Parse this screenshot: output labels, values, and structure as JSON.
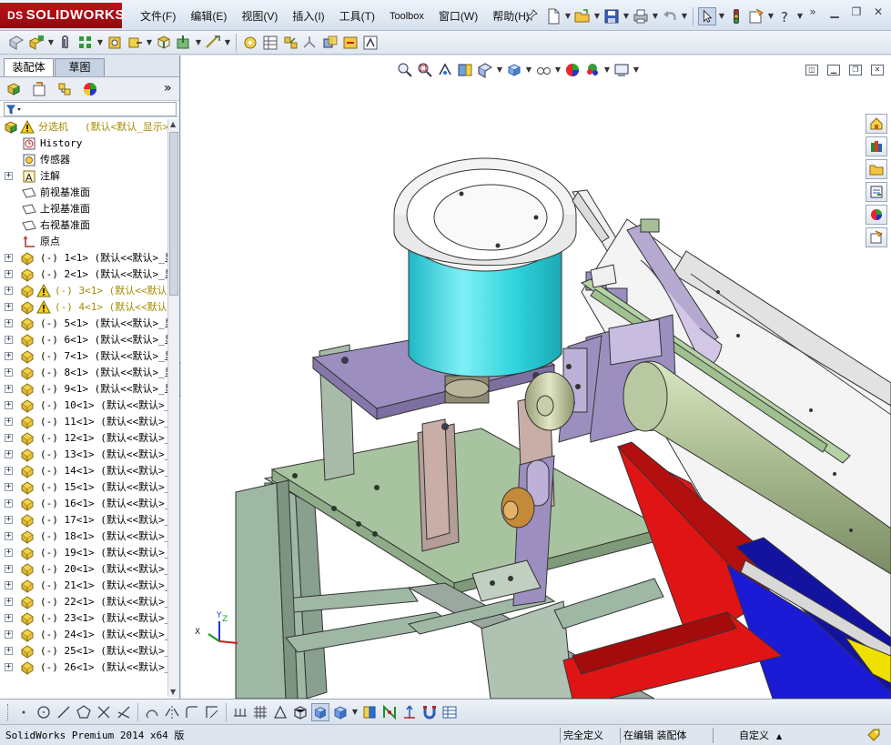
{
  "app": {
    "brand_mark": "DS",
    "brand": "SOLIDWORKS"
  },
  "menu": [
    {
      "label": "文件(F)"
    },
    {
      "label": "编辑(E)"
    },
    {
      "label": "视图(V)"
    },
    {
      "label": "插入(I)"
    },
    {
      "label": "工具(T)"
    },
    {
      "label": "Toolbox"
    },
    {
      "label": "窗口(W)"
    },
    {
      "label": "帮助(H)"
    }
  ],
  "panel": {
    "tabs": [
      {
        "label": "装配体"
      },
      {
        "label": "草图"
      }
    ],
    "expand_glyph": "»"
  },
  "tree": {
    "root": {
      "label": "分选机",
      "config": "(默认<默认_显示>"
    },
    "items": [
      {
        "label": "History"
      },
      {
        "label": "传感器"
      },
      {
        "label": "注解"
      },
      {
        "label": "前视基准面"
      },
      {
        "label": "上视基准面"
      },
      {
        "label": "右视基准面"
      },
      {
        "label": "原点"
      }
    ],
    "parts": [
      {
        "label": "(-) 1<1> (默认<<默认>_显",
        "warn": false
      },
      {
        "label": "(-) 2<1> (默认<<默认>_显",
        "warn": false
      },
      {
        "label": "(-) 3<1> (默认<<默认",
        "warn": true
      },
      {
        "label": "(-) 4<1> (默认<<默认",
        "warn": true
      },
      {
        "label": "(-) 5<1> (默认<<默认>_显",
        "warn": false
      },
      {
        "label": "(-) 6<1> (默认<<默认>_显",
        "warn": false
      },
      {
        "label": "(-) 7<1> (默认<<默认>_显",
        "warn": false
      },
      {
        "label": "(-) 8<1> (默认<<默认>_显",
        "warn": false
      },
      {
        "label": "(-) 9<1> (默认<<默认>_显",
        "warn": false
      },
      {
        "label": "(-) 10<1> (默认<<默认>_",
        "warn": false
      },
      {
        "label": "(-) 11<1> (默认<<默认>_",
        "warn": false
      },
      {
        "label": "(-) 12<1> (默认<<默认>_",
        "warn": false
      },
      {
        "label": "(-) 13<1> (默认<<默认>_",
        "warn": false
      },
      {
        "label": "(-) 14<1> (默认<<默认>_",
        "warn": false
      },
      {
        "label": "(-) 15<1> (默认<<默认>_",
        "warn": false
      },
      {
        "label": "(-) 16<1> (默认<<默认>_",
        "warn": false
      },
      {
        "label": "(-) 17<1> (默认<<默认>_",
        "warn": false
      },
      {
        "label": "(-) 18<1> (默认<<默认>_",
        "warn": false
      },
      {
        "label": "(-) 19<1> (默认<<默认>_",
        "warn": false
      },
      {
        "label": "(-) 20<1> (默认<<默认>_",
        "warn": false
      },
      {
        "label": "(-) 21<1> (默认<<默认>_",
        "warn": false
      },
      {
        "label": "(-) 22<1> (默认<<默认>_",
        "warn": false
      },
      {
        "label": "(-) 23<1> (默认<<默认>_",
        "warn": false
      },
      {
        "label": "(-) 24<1> (默认<<默认>_",
        "warn": false
      },
      {
        "label": "(-) 25<1> (默认<<默认>_",
        "warn": false
      },
      {
        "label": "(-) 26<1> (默认<<默认>_",
        "warn": false
      }
    ]
  },
  "triad": {
    "x": "X",
    "y": "Y",
    "z": "Z"
  },
  "status": {
    "app_version": "SolidWorks Premium 2014 x64 版",
    "definition": "完全定义",
    "editing": "在编辑 装配体",
    "units": "自定义"
  },
  "colors": {
    "brand_red": "#c40f17",
    "hopper_red": "#e01414",
    "bowl_cyan": "#2fd3dc",
    "plate_purple": "#9c8fc0",
    "frame_green": "#9fb8a4",
    "roller_olive": "#a7b88d",
    "plate_green": "#a8c3a0",
    "chute_blue": "#1b1bd6",
    "panel_bg": "#d9e3ef"
  }
}
